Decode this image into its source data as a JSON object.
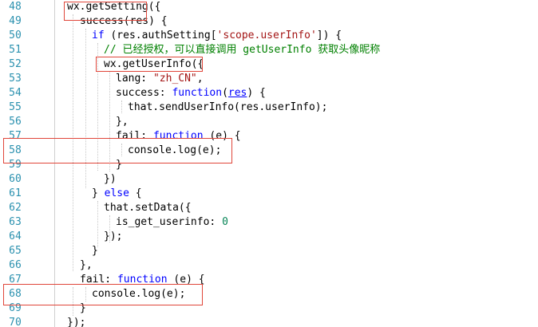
{
  "colors": {
    "line_number": "#2b91af",
    "keyword": "#0000ff",
    "string": "#a31515",
    "number": "#098658",
    "comment": "#008000",
    "highlight_box": "#e0463a"
  },
  "line_numbers": [
    "48",
    "49",
    "50",
    "51",
    "52",
    "53",
    "54",
    "55",
    "56",
    "57",
    "58",
    "59",
    "60",
    "61",
    "62",
    "63",
    "64",
    "65",
    "66",
    "67",
    "68",
    "69",
    "70"
  ],
  "code": {
    "l48": {
      "a": "wx.getSetting(",
      "b": "{"
    },
    "l49": {
      "a": "success(res) {"
    },
    "l50": {
      "kw": "if",
      "a": " (res.authSetting[",
      "str": "'scope.userInfo'",
      "b": "]) {"
    },
    "l51": {
      "cmt": "// 已经授权，可以直接调用 getUserInfo 获取头像昵称"
    },
    "l52": {
      "a": "wx.getUserInfo(",
      "b": "{"
    },
    "l53": {
      "a": "lang: ",
      "str": "\"zh_CN\"",
      "b": ","
    },
    "l54": {
      "a": "success: ",
      "kw": "function",
      "b": "(",
      "prm": "res",
      "c": ") {"
    },
    "l55": {
      "a": "that.sendUserInfo(res.userInfo);"
    },
    "l56": {
      "a": "},"
    },
    "l57": {
      "a": "fail: ",
      "kw": "function",
      "b": " (e) {"
    },
    "l58": {
      "a": "console.log(e);"
    },
    "l59": {
      "a": "}"
    },
    "l60": {
      "a": "})"
    },
    "l61": {
      "a": "} ",
      "kw": "else",
      "b": " {"
    },
    "l62": {
      "a": "that.setData({"
    },
    "l63": {
      "a": "is_get_userinfo: ",
      "num": "0"
    },
    "l64": {
      "a": "});"
    },
    "l65": {
      "a": "}"
    },
    "l66": {
      "a": "},"
    },
    "l67": {
      "a": "fail: ",
      "kw": "function",
      "b": " (e) {"
    },
    "l68": {
      "a": "console.log(e);"
    },
    "l69": {
      "a": "}"
    },
    "l70": {
      "a": "});"
    }
  }
}
